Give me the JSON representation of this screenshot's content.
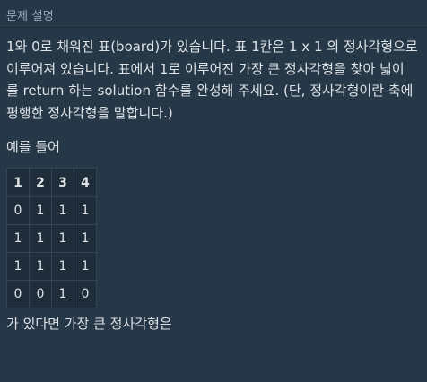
{
  "section": {
    "title": "문제 설명"
  },
  "problem": {
    "lines": [
      "1와 0로 채워진 표(board)가 있습니다. 표 1칸은 1 x 1 의 정사각형으로",
      "이루어져 있습니다. 표에서 1로 이루어진 가장 큰 정사각형을 찾아 넓이",
      "를 return 하는 solution 함수를 완성해 주세요. (단, 정사각형이란 축에",
      "평행한 정사각형을 말합니다.)"
    ],
    "example_label": "예를 들어",
    "table": {
      "header": [
        "1",
        "2",
        "3",
        "4"
      ],
      "rows": [
        [
          "0",
          "1",
          "1",
          "1"
        ],
        [
          "1",
          "1",
          "1",
          "1"
        ],
        [
          "1",
          "1",
          "1",
          "1"
        ],
        [
          "0",
          "0",
          "1",
          "0"
        ]
      ]
    },
    "after_label": "가 있다면 가장 큰 정사각형은"
  }
}
